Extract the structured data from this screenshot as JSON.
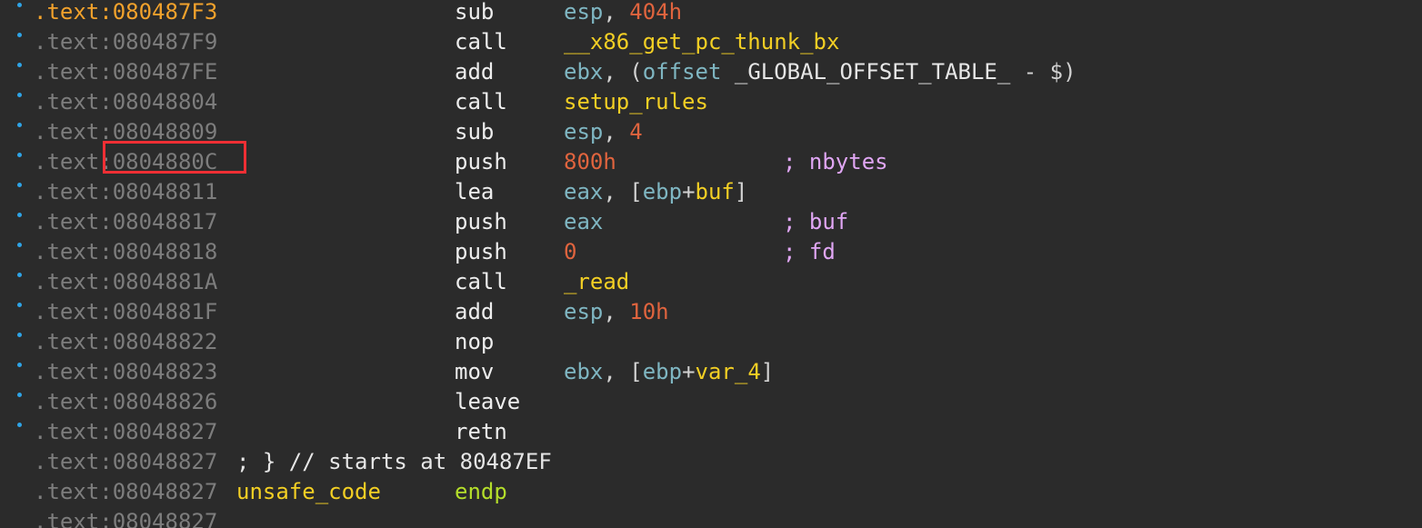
{
  "colors": {
    "background": "#2b2b2b",
    "address": "#7d7d7d",
    "current_address": "#f2a22c",
    "mnemonic": "#eeeeee",
    "register": "#7fb6c2",
    "number": "#e0643e",
    "symbol": "#f3cf24",
    "comment": "#e0a6f4",
    "keyword": "#b4de2a",
    "highlight_box": "#ef2f34",
    "breakpoint_dot": "#2ea4e6"
  },
  "lines": [
    {
      "addr": ".text:080487F3",
      "mnem": "sub",
      "ops": [
        {
          "t": "esp",
          "c": "reg"
        },
        {
          "t": ", ",
          "c": "punc"
        },
        {
          "t": "404h",
          "c": "num"
        }
      ]
    },
    {
      "addr": ".text:080487F9",
      "mnem": "call",
      "ops": [
        {
          "t": "__x86_get_pc_thunk_bx",
          "c": "sym"
        }
      ]
    },
    {
      "addr": ".text:080487FE",
      "mnem": "add",
      "ops": [
        {
          "t": "ebx",
          "c": "reg"
        },
        {
          "t": ", (",
          "c": "punc"
        },
        {
          "t": "offset ",
          "c": "reg"
        },
        {
          "t": "_GLOBAL_OFFSET_TABLE_",
          "c": "white"
        },
        {
          "t": " - $)",
          "c": "punc"
        }
      ]
    },
    {
      "addr": ".text:08048804",
      "mnem": "call",
      "ops": [
        {
          "t": "setup_rules",
          "c": "sym"
        }
      ]
    },
    {
      "addr": ".text:08048809",
      "mnem": "sub",
      "ops": [
        {
          "t": "esp",
          "c": "reg"
        },
        {
          "t": ", ",
          "c": "punc"
        },
        {
          "t": "4",
          "c": "num"
        }
      ]
    },
    {
      "addr": ".text:0804880C",
      "mnem": "push",
      "ops": [
        {
          "t": "800h",
          "c": "num"
        }
      ],
      "comment": "; nbytes"
    },
    {
      "addr": ".text:08048811",
      "mnem": "lea",
      "ops": [
        {
          "t": "eax",
          "c": "reg"
        },
        {
          "t": ", [",
          "c": "punc"
        },
        {
          "t": "ebp",
          "c": "reg"
        },
        {
          "t": "+",
          "c": "punc"
        },
        {
          "t": "buf",
          "c": "sym"
        },
        {
          "t": "]",
          "c": "punc"
        }
      ]
    },
    {
      "addr": ".text:08048817",
      "mnem": "push",
      "ops": [
        {
          "t": "eax",
          "c": "reg"
        }
      ],
      "comment": "; buf"
    },
    {
      "addr": ".text:08048818",
      "mnem": "push",
      "ops": [
        {
          "t": "0",
          "c": "num"
        }
      ],
      "comment": "; fd"
    },
    {
      "addr": ".text:0804881A",
      "mnem": "call",
      "ops": [
        {
          "t": "_read",
          "c": "sym"
        }
      ]
    },
    {
      "addr": ".text:0804881F",
      "mnem": "add",
      "ops": [
        {
          "t": "esp",
          "c": "reg"
        },
        {
          "t": ", ",
          "c": "punc"
        },
        {
          "t": "10h",
          "c": "num"
        }
      ]
    },
    {
      "addr": ".text:08048822",
      "mnem": "nop",
      "ops": []
    },
    {
      "addr": ".text:08048823",
      "mnem": "mov",
      "ops": [
        {
          "t": "ebx",
          "c": "reg"
        },
        {
          "t": ", [",
          "c": "punc"
        },
        {
          "t": "ebp",
          "c": "reg"
        },
        {
          "t": "+",
          "c": "punc"
        },
        {
          "t": "var_4",
          "c": "sym"
        },
        {
          "t": "]",
          "c": "punc"
        }
      ]
    },
    {
      "addr": ".text:08048826",
      "mnem": "leave",
      "ops": []
    },
    {
      "addr": ".text:08048827",
      "mnem": "retn",
      "ops": []
    },
    {
      "addr": ".text:08048827",
      "label": [
        {
          "t": "; } // starts at 80487EF",
          "c": "white"
        }
      ]
    },
    {
      "addr": ".text:08048827",
      "label": [
        {
          "t": "unsafe_code",
          "c": "sym"
        }
      ],
      "endp": "endp"
    },
    {
      "addr": ".text:08048827"
    }
  ]
}
